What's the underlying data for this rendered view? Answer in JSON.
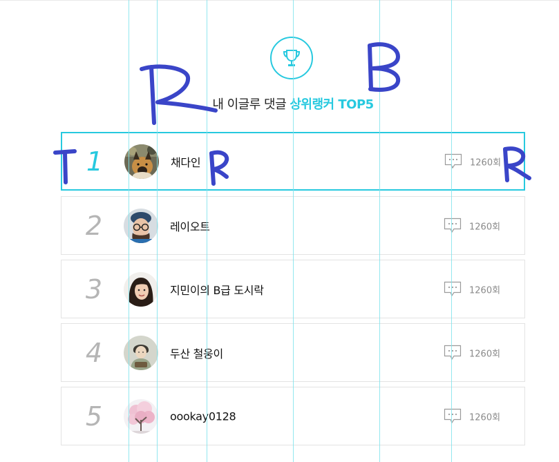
{
  "colors": {
    "accent": "#27c9df",
    "ink": "#3a45c8",
    "guide": "#7fe3ec"
  },
  "header": {
    "icon": "trophy-icon",
    "title_prefix": "내 이글루 댓글 ",
    "title_accent": "상위랭커 TOP5"
  },
  "rankers": [
    {
      "rank": "1",
      "name": "채다인",
      "count": "1260회",
      "avatar": "dog-avatar",
      "active": true
    },
    {
      "rank": "2",
      "name": "레이오트",
      "count": "1260회",
      "avatar": "glasses-woman-avatar",
      "active": false
    },
    {
      "rank": "3",
      "name": "지민이의 B급 도시락",
      "count": "1260회",
      "avatar": "woman-avatar",
      "active": false
    },
    {
      "rank": "4",
      "name": "두산 철웅이",
      "count": "1260회",
      "avatar": "illustration-avatar",
      "active": false
    },
    {
      "rank": "5",
      "name": "oookay0128",
      "count": "1260회",
      "avatar": "cherry-tree-avatar",
      "active": false
    }
  ]
}
